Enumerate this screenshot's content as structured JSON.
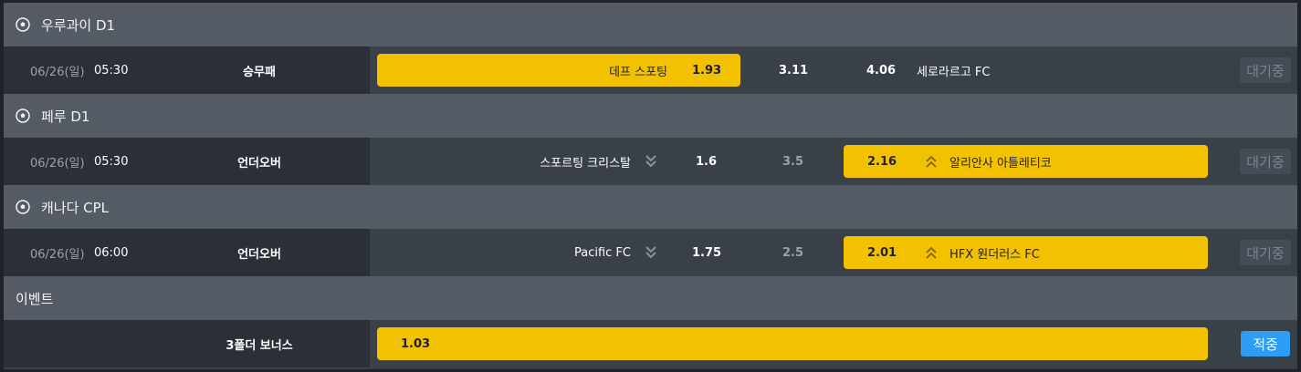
{
  "leagues": [
    {
      "name": "우루과이 D1",
      "match": {
        "date": "06/26(일)",
        "time": "05:30",
        "market": "승무패",
        "home_team": "데프 스포팅",
        "home_odd": "1.93",
        "draw_odd": "3.11",
        "away_odd": "4.06",
        "away_team": "세로라르고 FC",
        "status": "대기중"
      }
    },
    {
      "name": "페루 D1",
      "match": {
        "date": "06/26(일)",
        "time": "05:30",
        "market": "언더오버",
        "home_team": "스포르팅 크리스탈",
        "under_odd": "1.6",
        "line": "3.5",
        "over_odd": "2.16",
        "away_team": "알리안사 아틀레티코",
        "status": "대기중"
      }
    },
    {
      "name": "캐나다 CPL",
      "match": {
        "date": "06/26(일)",
        "time": "06:00",
        "market": "언더오버",
        "home_team": "Pacific FC",
        "under_odd": "1.75",
        "line": "2.5",
        "over_odd": "2.01",
        "away_team": "HFX 원더러스 FC",
        "status": "대기중"
      }
    }
  ],
  "event": {
    "name": "이벤트",
    "market": "3폴더 보너스",
    "odd": "1.03",
    "button": "적중"
  },
  "icons": {
    "league": "soccer-ball-icon",
    "under": "double-chevron-down-icon",
    "over": "double-chevron-up-icon"
  },
  "colors": {
    "selected": "#f2c100",
    "bet_button": "#2e9cf2"
  }
}
